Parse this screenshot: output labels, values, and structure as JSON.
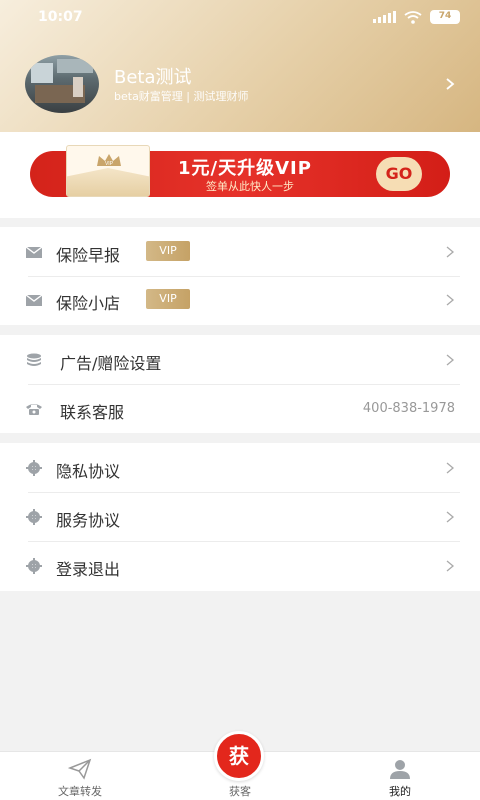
{
  "status": {
    "time": "10:07",
    "battery": "74"
  },
  "profile": {
    "name": "Beta测试",
    "subtitle": "beta财富管理 | 测试理财师"
  },
  "banner": {
    "title": "1元/天升级VIP",
    "subtitle": "签单从此快人一步",
    "go_label": "GO",
    "crown_text": "VIP"
  },
  "group1": [
    {
      "label": "保险早报",
      "badge": "VIP",
      "icon": "mail-icon"
    },
    {
      "label": "保险小店",
      "badge": "VIP",
      "icon": "mail-icon"
    }
  ],
  "group2": [
    {
      "label": "广告/赠险设置",
      "icon": "coins-icon"
    },
    {
      "label": "联系客服",
      "value": "400-838-1978",
      "icon": "phone-icon"
    }
  ],
  "group3": [
    {
      "label": "隐私协议",
      "icon": "gear-icon"
    },
    {
      "label": "服务协议",
      "icon": "gear-icon"
    },
    {
      "label": "登录退出",
      "icon": "gear-icon"
    }
  ],
  "tabbar": {
    "tabs": [
      {
        "label": "文章转发",
        "icon": "paper-plane-icon"
      },
      {
        "label": "获客",
        "icon": "huo-logo-icon"
      },
      {
        "label": "我的",
        "icon": "person-icon"
      }
    ],
    "center_glyph": "获",
    "active_tab": "我的"
  },
  "colors": {
    "accent": "#e3271c",
    "gold": "#c9a56b",
    "header_gold": "#dcc194"
  }
}
